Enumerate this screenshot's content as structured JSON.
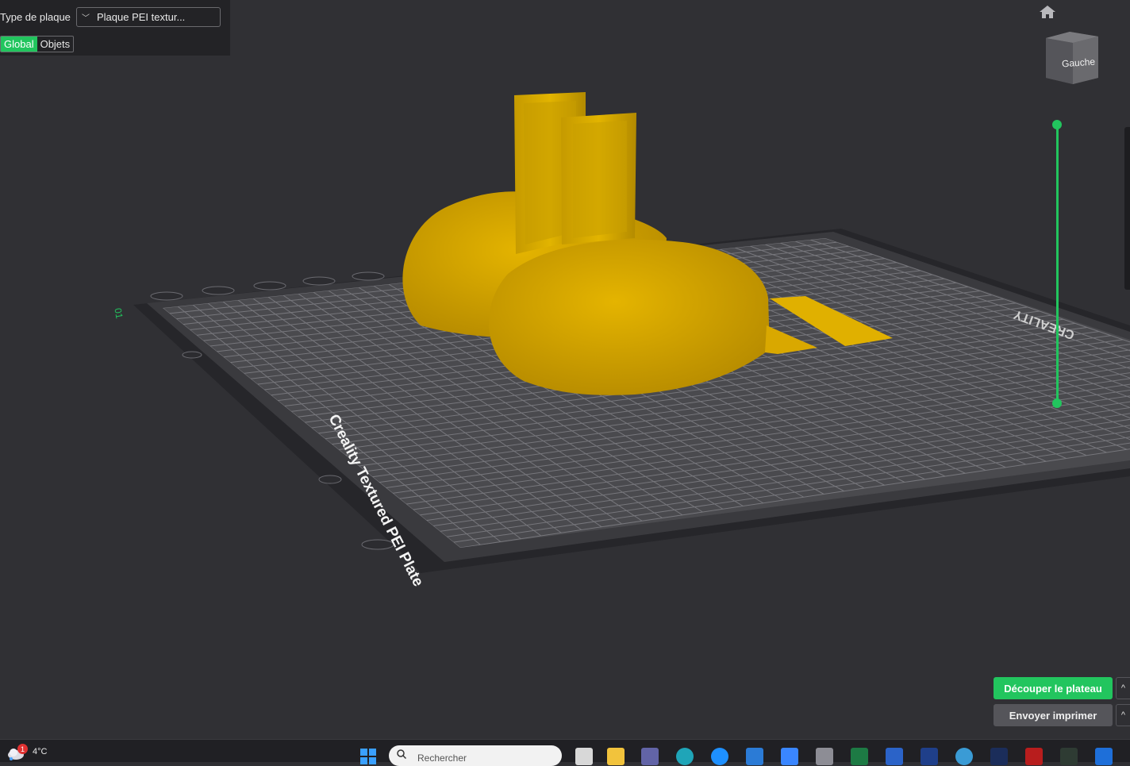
{
  "top_panel": {
    "plate_type_label": "Type de plaque",
    "plate_type_value": "Plaque PEI textur...",
    "tabs": [
      "Global",
      "Objets"
    ],
    "active_tab": "Global"
  },
  "view_cube": {
    "label": "Gauche"
  },
  "bed": {
    "plate_text": "Creality Textured PEI Plate",
    "brand_text": "CREALITY",
    "plate_number": "01"
  },
  "actions": {
    "slice_label": "Découper le plateau",
    "send_label": "Envoyer imprimer",
    "expand_glyph": "^"
  },
  "taskbar": {
    "weather_temp": "4°C",
    "notification_count": "1",
    "search_placeholder": "Rechercher",
    "app_icons": [
      "windows-start",
      "task-view",
      "file-explorer",
      "teams",
      "edge",
      "help",
      "store",
      "3d-app",
      "calculator",
      "excel",
      "word",
      "maps",
      "browser",
      "tc",
      "lc",
      "slicer",
      "creality"
    ]
  },
  "colors": {
    "accent": "#22c55e",
    "model": "#d9a800",
    "background": "#303034"
  }
}
